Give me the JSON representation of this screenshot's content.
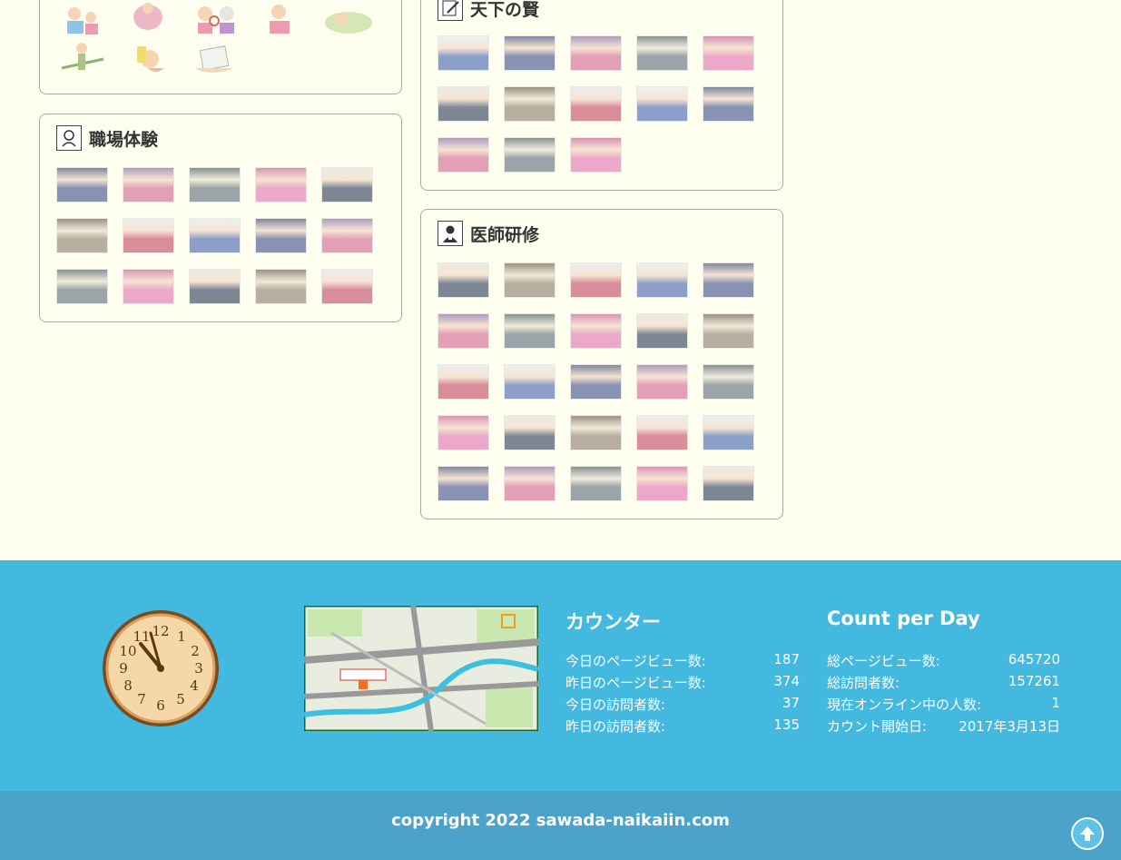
{
  "panels": {
    "workplace": {
      "title": "職場体験",
      "icon": "child-worker-icon"
    },
    "sages": {
      "title": "天下の賢",
      "icon": "notebook-pencil-icon"
    },
    "doctor": {
      "title": "医師研修",
      "icon": "doctor-icon"
    }
  },
  "counter": {
    "title": "カウンター",
    "rows": [
      {
        "label": "今日のページビュー数:",
        "value": "187"
      },
      {
        "label": "昨日のページビュー数:",
        "value": "374"
      },
      {
        "label": "今日の訪問者数:",
        "value": "37"
      },
      {
        "label": "昨日の訪問者数:",
        "value": "135"
      }
    ]
  },
  "count_per_day": {
    "title": "Count per Day",
    "rows": [
      {
        "label": "総ページビュー数:",
        "value": "645720"
      },
      {
        "label": "総訪問者数:",
        "value": "157261"
      },
      {
        "label": "現在オンライン中の人数:",
        "value": "1"
      },
      {
        "label": "カウント開始日:",
        "value": "2017年3月13日"
      }
    ]
  },
  "footer": {
    "copyright": "copyright 2022 sawada-naikaiin.com"
  },
  "colors": {
    "footer_bg": "#43b9df",
    "copyright_bg": "#4ba3cc",
    "page_bg": "#fffff0"
  }
}
